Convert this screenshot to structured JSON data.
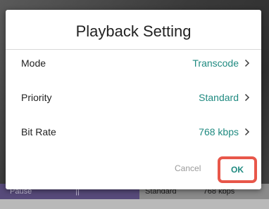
{
  "dialog": {
    "title": "Playback Setting",
    "rows": [
      {
        "label": "Mode",
        "value": "Transcode"
      },
      {
        "label": "Priority",
        "value": "Standard"
      },
      {
        "label": "Bit Rate",
        "value": "768 kbps"
      }
    ],
    "cancel_label": "Cancel",
    "ok_label": "OK"
  },
  "background_bar": {
    "left_label": "Pause",
    "left_separator": "||",
    "priority": "Standard",
    "bitrate": "768 kbps"
  },
  "colors": {
    "accent": "#1f8a80",
    "highlight_border": "#e8574a",
    "cancel_text": "#9a9a9a"
  },
  "icons": {
    "row_chevron": "chevron-right-icon"
  }
}
